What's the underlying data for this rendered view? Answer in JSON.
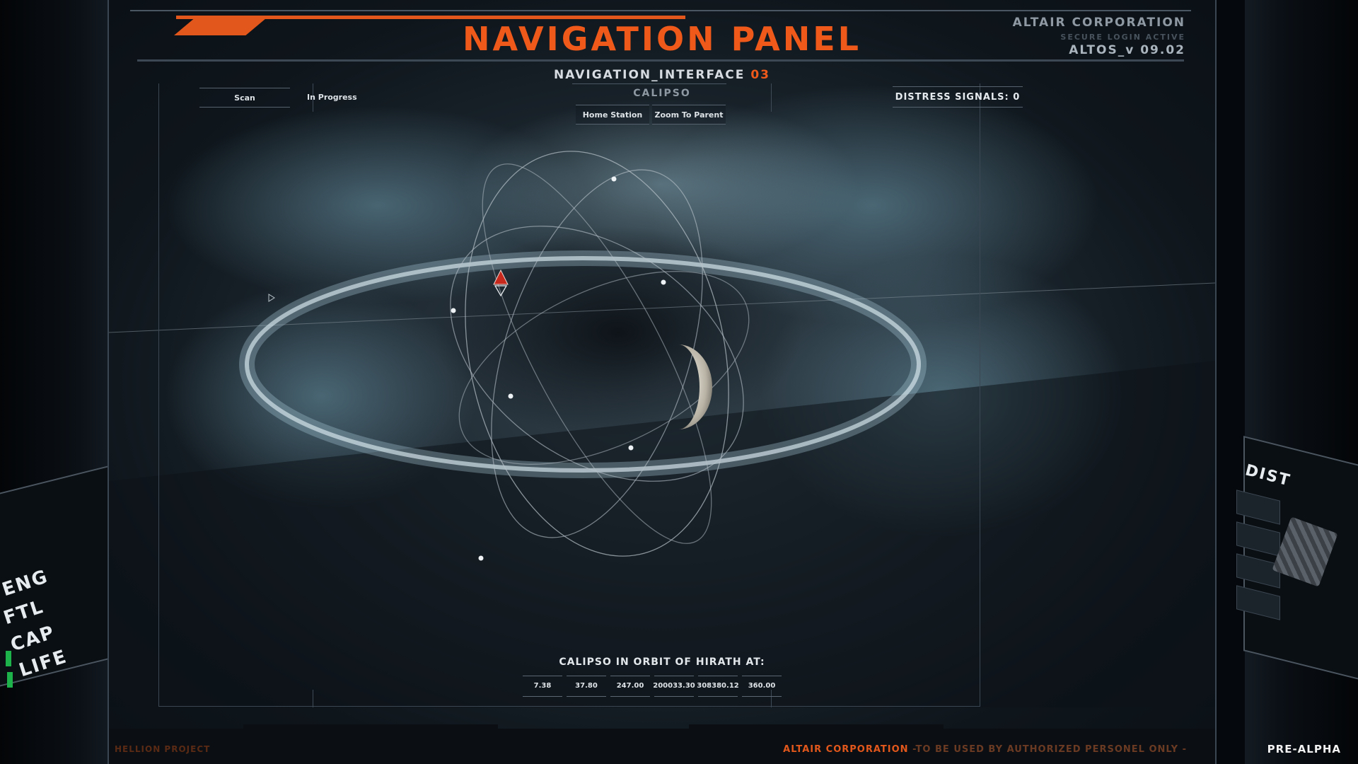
{
  "header": {
    "title": "NAVIGATION PANEL",
    "corp_name": "ALTAIR CORPORATION",
    "login_status": "SECURE LOGIN ACTIVE",
    "version": "ALTOS_v 09.02"
  },
  "interface": {
    "label": "NAVIGATION_INTERFACE",
    "number": "03"
  },
  "toolbar": {
    "scan_label": "Scan",
    "progress_label": "In Progress",
    "location_name": "CALIPSO",
    "home_label": "Home Station",
    "zoom_label": "Zoom To Parent",
    "distress_label": "DISTRESS SIGNALS: 0"
  },
  "orbit": {
    "label": "CALIPSO IN ORBIT OF HIRATH AT:",
    "values": [
      "7.38",
      "37.80",
      "247.00",
      "200033.30",
      "308380.12",
      "360.00"
    ]
  },
  "footer": {
    "left": "HELLION PROJECT",
    "right_corp": "ALTAIR CORPORATION",
    "right_notice": " -TO BE USED BY AUTHORIZED PERSONEL ONLY -"
  },
  "cockpit": {
    "left_stats": [
      "ENG",
      "FTL",
      "CAP",
      "LIFE"
    ],
    "right_label": "DIST",
    "badge": "PRE-ALPHA"
  },
  "colors": {
    "accent": "#ef5a1a",
    "status_green": "#1db34a"
  }
}
